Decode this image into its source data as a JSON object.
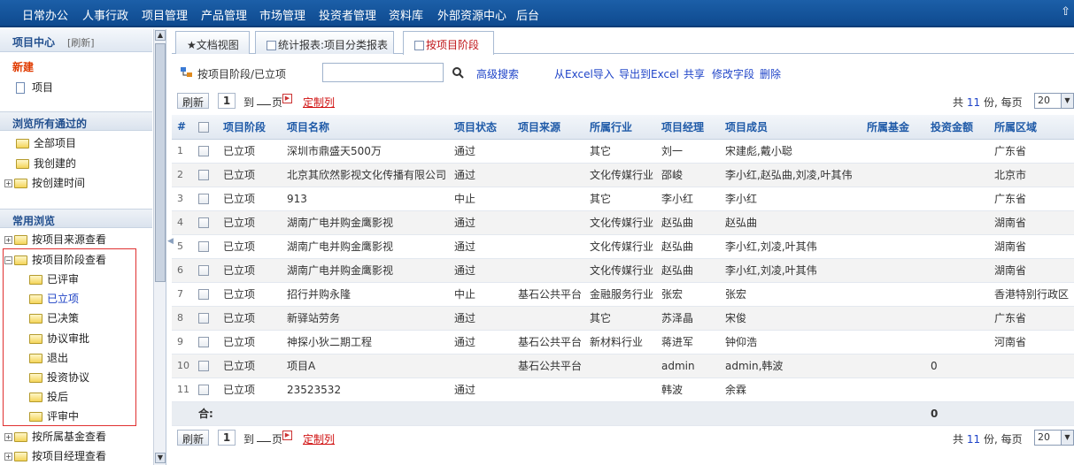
{
  "topnav": {
    "items": [
      "日常办公",
      "人事行政",
      "项目管理",
      "产品管理",
      "市场管理",
      "投资者管理",
      "资料库",
      "外部资源中心",
      "后台"
    ]
  },
  "sidebar": {
    "title": "项目中心",
    "refresh": "[刷新]",
    "new_label": "新建",
    "new_item": "项目",
    "browse_passed": "浏览所有通过的",
    "passed_items": [
      "全部项目",
      "我创建的",
      "按创建时间"
    ],
    "common_browse": "常用浏览",
    "common_items": [
      "按项目来源查看",
      "按项目阶段查看"
    ],
    "stage_items": [
      "已评审",
      "已立项",
      "已决策",
      "协议审批",
      "退出",
      "投资协议",
      "投后",
      "评审中"
    ],
    "active_stage": "已立项",
    "bottom_items": [
      "按所属基金查看",
      "按项目经理查看"
    ]
  },
  "tabs": [
    "★文档视图",
    "统计报表:项目分类报表",
    "按项目阶段"
  ],
  "toolbar": {
    "path": "按项目阶段/已立项",
    "search_placeholder": "",
    "advanced_search": "高级搜索",
    "links": [
      "从Excel导入",
      "导出到Excel",
      "共享",
      "修改字段",
      "删除"
    ]
  },
  "pager": {
    "refresh": "刷新",
    "page": "1",
    "to": "到",
    "page_unit": "页",
    "customize": "定制列",
    "total_prefix": "共",
    "total_count": "11",
    "total_suffix": "份,",
    "per_page_label": "每页",
    "per_page": "20"
  },
  "table": {
    "headers": [
      "#",
      "",
      "项目阶段",
      "项目名称",
      "项目状态",
      "项目来源",
      "所属行业",
      "项目经理",
      "项目成员",
      "所属基金",
      "投资金额",
      "所属区域"
    ],
    "rows": [
      [
        "1",
        "已立项",
        "深圳市鼎盛天500万",
        "通过",
        "",
        "其它",
        "刘一",
        "宋建彪,戴小聪",
        "",
        "",
        "广东省"
      ],
      [
        "2",
        "已立项",
        "北京其欣然影视文化传播有限公司",
        "通过",
        "",
        "文化传媒行业",
        "邵峻",
        "李小红,赵弘曲,刘凌,叶其伟",
        "",
        "",
        "北京市"
      ],
      [
        "3",
        "已立项",
        "913",
        "中止",
        "",
        "其它",
        "李小红",
        "李小红",
        "",
        "",
        "广东省"
      ],
      [
        "4",
        "已立项",
        "湖南广电并购金鹰影视",
        "通过",
        "",
        "文化传媒行业",
        "赵弘曲",
        "赵弘曲",
        "",
        "",
        "湖南省"
      ],
      [
        "5",
        "已立项",
        "湖南广电并购金鹰影视",
        "通过",
        "",
        "文化传媒行业",
        "赵弘曲",
        "李小红,刘凌,叶其伟",
        "",
        "",
        "湖南省"
      ],
      [
        "6",
        "已立项",
        "湖南广电并购金鹰影视",
        "通过",
        "",
        "文化传媒行业",
        "赵弘曲",
        "李小红,刘凌,叶其伟",
        "",
        "",
        "湖南省"
      ],
      [
        "7",
        "已立项",
        "招行并购永隆",
        "中止",
        "基石公共平台",
        "金融服务行业",
        "张宏",
        "张宏",
        "",
        "",
        "香港特别行政区"
      ],
      [
        "8",
        "已立项",
        "新驿站劳务",
        "通过",
        "",
        "其它",
        "苏泽晶",
        "宋俊",
        "",
        "",
        "广东省"
      ],
      [
        "9",
        "已立项",
        "神探小狄二期工程",
        "通过",
        "基石公共平台",
        "新材料行业",
        "蒋进军",
        "钟仰浩",
        "",
        "",
        "河南省"
      ],
      [
        "10",
        "已立项",
        "项目A",
        "",
        "基石公共平台",
        "",
        "admin",
        "admin,韩波",
        "",
        "0",
        ""
      ],
      [
        "11",
        "已立项",
        "23523532",
        "通过",
        "",
        "",
        "韩波",
        "余霖",
        "",
        "",
        ""
      ]
    ],
    "sum_label": "合:",
    "sum_invest": "0"
  }
}
